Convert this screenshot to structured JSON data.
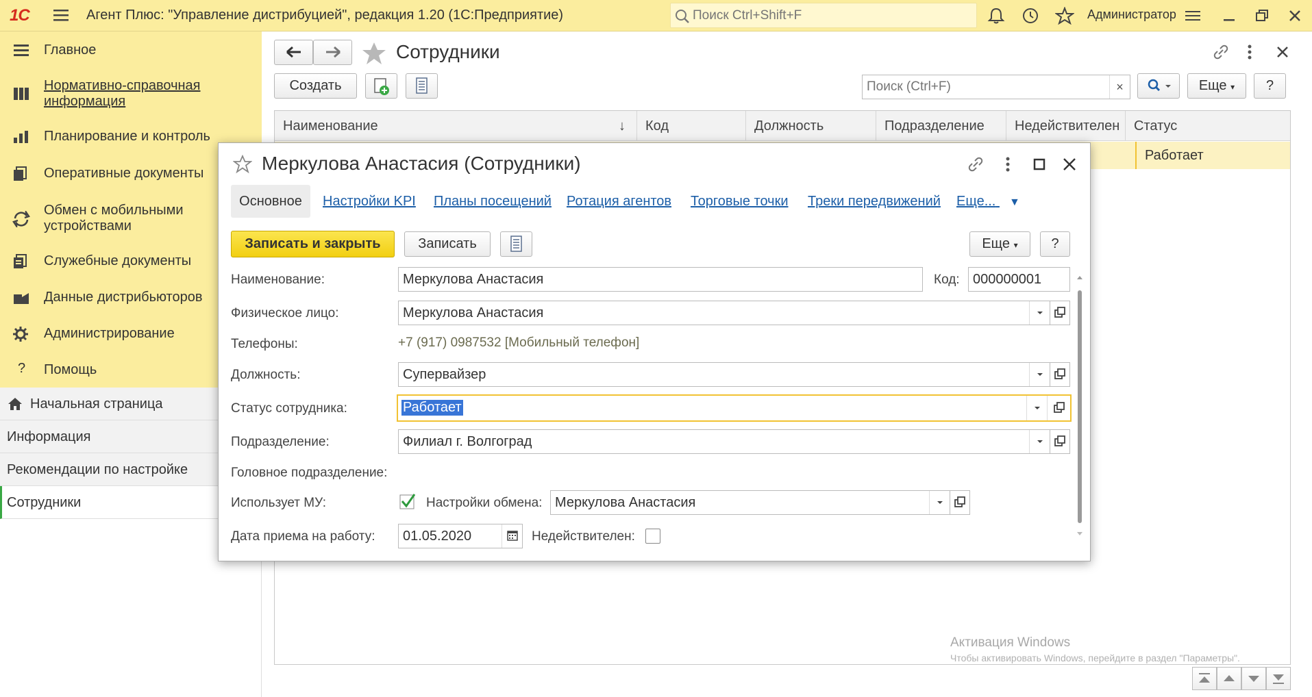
{
  "topbar": {
    "logo": "1С",
    "title": "Агент Плюс: \"Управление дистрибуцией\", редакция 1.20  (1С:Предприятие)",
    "search_placeholder": "Поиск Ctrl+Shift+F",
    "user": "Администратор"
  },
  "sidebar": {
    "items": [
      {
        "label": "Главное",
        "icon": "menu-lines-icon"
      },
      {
        "label": "Нормативно-справочная информация",
        "icon": "grid-icon"
      },
      {
        "label": "Планирование и контроль",
        "icon": "bar-chart-icon"
      },
      {
        "label": "Оперативные документы",
        "icon": "documents-icon"
      },
      {
        "label": "Обмен с мобильными устройствами",
        "icon": "sync-icon"
      },
      {
        "label": "Служебные документы",
        "icon": "service-docs-icon"
      },
      {
        "label": "Данные дистрибьюторов",
        "icon": "distributor-icon"
      },
      {
        "label": "Администрирование",
        "icon": "gear-icon"
      },
      {
        "label": "Помощь",
        "icon": "question-icon"
      }
    ],
    "lower": [
      {
        "label": "Начальная страница",
        "icon": "home-icon"
      },
      {
        "label": "Информация"
      },
      {
        "label": "Рекомендации по настройке"
      },
      {
        "label": "Сотрудники"
      }
    ]
  },
  "list": {
    "title": "Сотрудники",
    "create_label": "Создать",
    "search_placeholder": "Поиск (Ctrl+F)",
    "clear": "×",
    "more_label": "Еще",
    "help_label": "?",
    "columns": [
      "Наименование",
      "Код",
      "Должность",
      "Подразделение",
      "Недействителен",
      "Статус"
    ],
    "sort_arrow": "↓",
    "row_status": "Работает",
    "watermark_title": "Активация Windows",
    "watermark_text": "Чтобы активировать Windows, перейдите в раздел \"Параметры\"."
  },
  "dialog": {
    "title": "Меркулова Анастасия (Сотрудники)",
    "tabs": [
      "Основное",
      "Настройки KPI",
      "Планы посещений",
      "Ротация агентов",
      "Торговые точки",
      "Треки передвижений",
      "Еще..."
    ],
    "save_close": "Записать и закрыть",
    "save": "Записать",
    "more": "Еще",
    "help": "?",
    "fields": {
      "name_label": "Наименование:",
      "name_value": "Меркулова Анастасия",
      "code_label": "Код:",
      "code_value": "000000001",
      "person_label": "Физическое лицо:",
      "person_value": "Меркулова Анастасия",
      "phones_label": "Телефоны:",
      "phones_value": "+7 (917) 0987532 [Мобильный телефон]",
      "position_label": "Должность:",
      "position_value": "Супервайзер",
      "status_label": "Статус сотрудника:",
      "status_value": "Работает",
      "dept_label": "Подразделение:",
      "dept_value": "Филиал г. Волгоград",
      "head_dept_label": "Головное подразделение:",
      "uses_mu_label": "Использует МУ:",
      "exchange_label": "Настройки обмена:",
      "exchange_value": "Меркулова Анастасия",
      "hire_date_label": "Дата приема на работу:",
      "hire_date_value": "01.05.2020",
      "invalid_label": "Недействителен:"
    },
    "uses_mu_checked": true,
    "invalid_checked": false
  }
}
